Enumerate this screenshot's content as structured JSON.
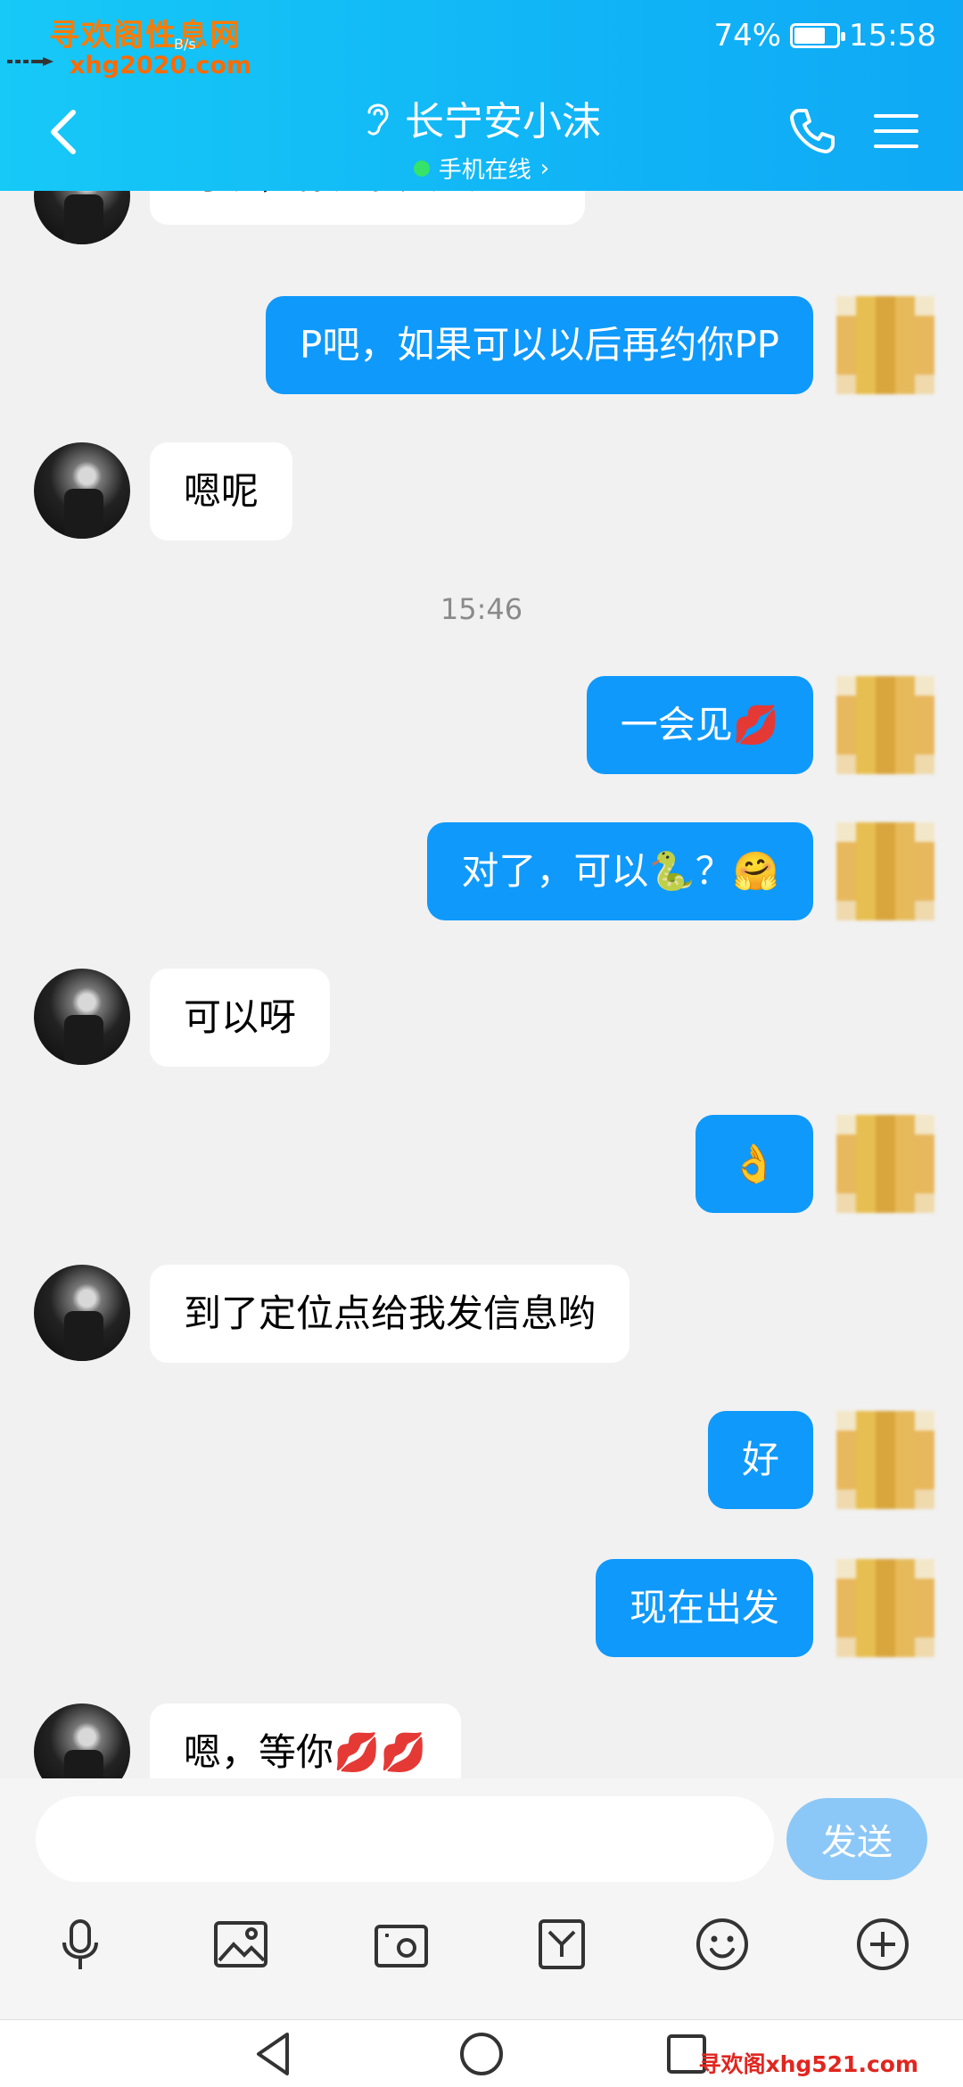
{
  "status_bar": {
    "watermark_top": "寻欢阁性息网",
    "watermark_url": "xhg2020.com",
    "network": "B/s",
    "battery_percent": "74%",
    "battery_level": 0.74,
    "time": "15:58"
  },
  "header": {
    "title": "长宁安小沫",
    "subtitle": "手机在线",
    "subtitle_chevron": "›"
  },
  "messages": [
    {
      "side": "in",
      "text": "可以，你是要P还是PP"
    },
    {
      "side": "out",
      "text": "P吧，如果可以以后再约你PP"
    },
    {
      "side": "in",
      "text": "嗯呢"
    },
    {
      "side": "time",
      "text": "15:46"
    },
    {
      "side": "out",
      "text": "一会见💋"
    },
    {
      "side": "out",
      "text": "对了，可以🐍？🤗"
    },
    {
      "side": "in",
      "text": "可以呀"
    },
    {
      "side": "out",
      "text": "👌"
    },
    {
      "side": "in",
      "text": "到了定位点给我发信息哟"
    },
    {
      "side": "out",
      "text": "好"
    },
    {
      "side": "out",
      "text": "现在出发"
    },
    {
      "side": "in",
      "text": "嗯，等你💋💋"
    }
  ],
  "input": {
    "placeholder": "",
    "send_label": "发送"
  },
  "toolbar_icons": [
    "microphone-icon",
    "image-icon",
    "camera-icon",
    "file-icon",
    "emoji-icon",
    "plus-icon"
  ],
  "watermark_bottom": "寻欢阁xhg521.com",
  "colors": {
    "header_start": "#16c9f7",
    "header_end": "#0fa9f5",
    "outgoing_bubble": "#0f99fb",
    "incoming_bubble": "#ffffff",
    "send_button": "#8cc8f7",
    "online_dot": "#35e36a"
  }
}
